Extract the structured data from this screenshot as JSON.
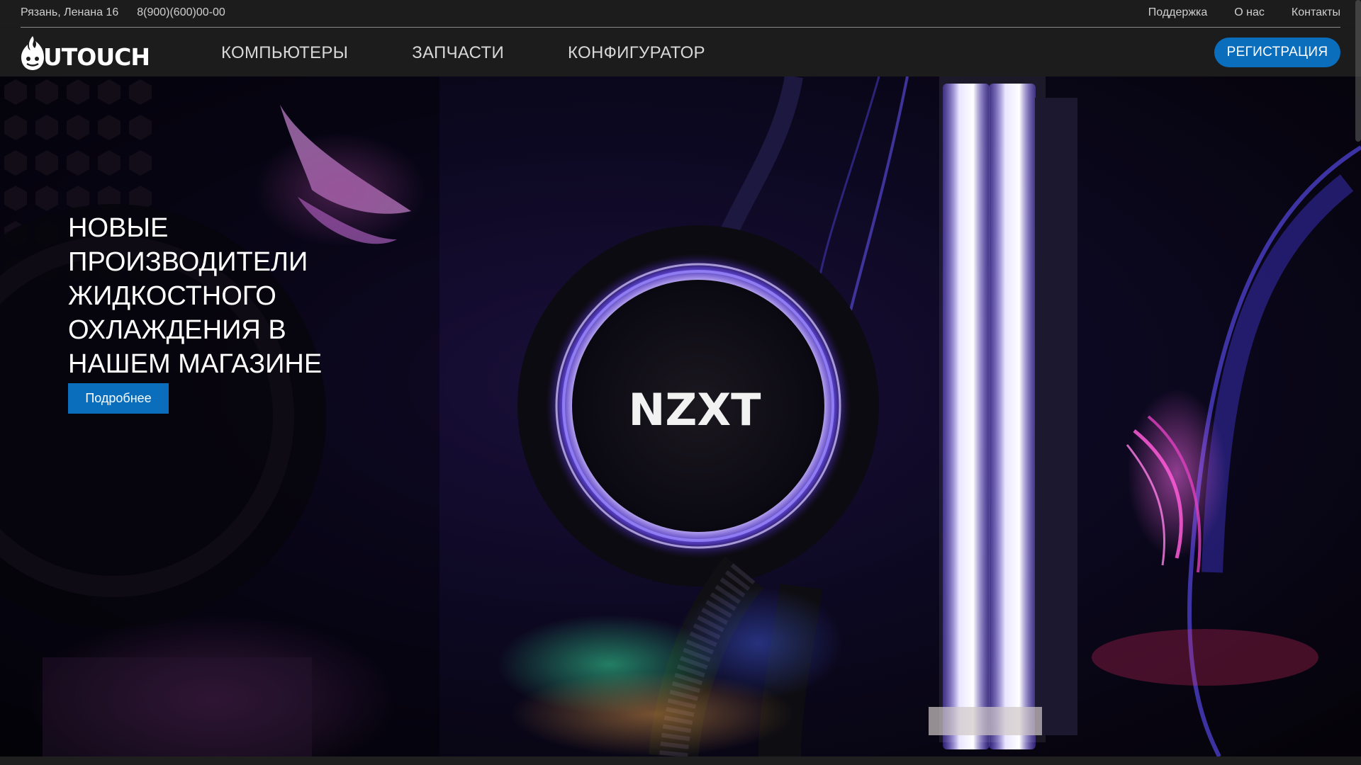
{
  "topbar": {
    "address": "Рязань, Ленана 16",
    "phone": "8(900)(600)00-00",
    "links": [
      "Поддержка",
      "О нас",
      "Контакты"
    ]
  },
  "nav": {
    "logo_text": "UTOUCH",
    "items": [
      "КОМПЬЮТЕРЫ",
      "ЗАПЧАСТИ",
      "КОНФИГУРАТОР"
    ],
    "register_label": "РЕГИСТРАЦИЯ"
  },
  "hero": {
    "title": "НОВЫЕ ПРОИЗВОДИТЕЛИ ЖИДКОСТНОГО ОХЛАЖДЕНИЯ В НАШЕМ МАГАЗИНЕ",
    "button_label": "Подробнее",
    "pump_brand": "NZXT"
  },
  "colors": {
    "accent": "#0a6ebd",
    "bar_bg": "#1c1c1c"
  }
}
